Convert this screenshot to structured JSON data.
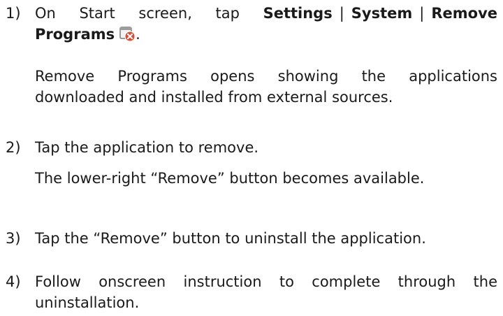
{
  "steps": [
    {
      "number": "1)",
      "prefix": "On Start screen, tap ",
      "settings": "Settings",
      "separator1": "|",
      "system": "System",
      "separator2": "|",
      "remove_programs": "Remove Programs",
      "icon": "remove-programs-icon",
      "suffix": ".",
      "note": "Remove Programs opens showing the applications downloaded and installed from external sources."
    },
    {
      "number": "2)",
      "text": "Tap the application to remove.",
      "note": "The lower-right “Remove” button becomes available."
    },
    {
      "number": "3)",
      "text": "Tap the “Remove” button to uninstall the application."
    },
    {
      "number": "4)",
      "text": "Follow onscreen instruction to complete through the uninstallation."
    }
  ],
  "colors": {
    "text": "#1a1a1a",
    "icon_red": "#e04a2f",
    "icon_body": "#8a8a8a"
  }
}
